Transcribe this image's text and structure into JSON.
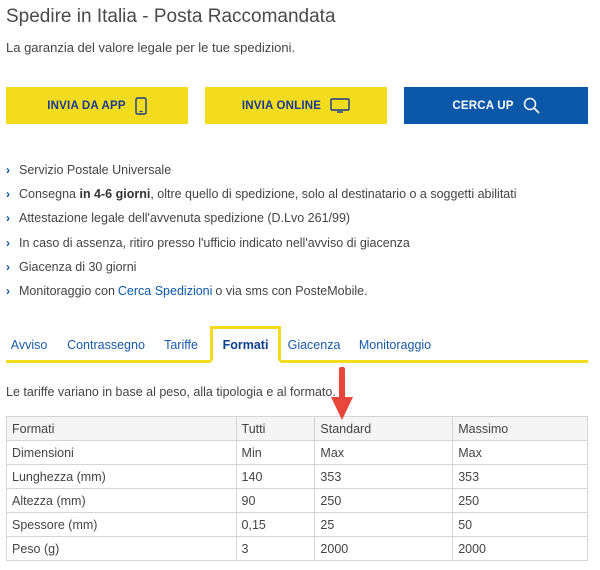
{
  "page": {
    "title": "Spedire in Italia - Posta Raccomandata",
    "subtitle": "La garanzia del valore legale per le tue spedizioni."
  },
  "buttons": {
    "app": "INVIA DA APP",
    "online": "INVIA ONLINE",
    "cerca": "CERCA UP"
  },
  "features": [
    {
      "text": "Servizio Postale Universale"
    },
    {
      "pre": "Consegna ",
      "bold": "in 4-6 giorni",
      "post": ", oltre quello di spedizione, solo al destinatario o a soggetti abilitati"
    },
    {
      "text": "Attestazione legale dell'avvenuta spedizione (D.Lvo 261/99)"
    },
    {
      "text": "In caso di assenza, ritiro presso l'ufficio indicato nell'avviso di giacenza"
    },
    {
      "text": "Giacenza di 30 giorni"
    },
    {
      "pre": "Monitoraggio con",
      "link": "Cerca Spedizioni",
      "post": "o via sms con PosteMobile."
    }
  ],
  "tabs": [
    "Avviso",
    "Contrassegno",
    "Tariffe",
    "Formati",
    "Giacenza",
    "Monitoraggio"
  ],
  "active_tab": "Formati",
  "note": "Le tariffe variano in base al peso, alla tipologia e al formato.",
  "table": {
    "headers": [
      "Formati",
      "Tutti",
      "Standard",
      "Massimo"
    ],
    "rows": [
      [
        "Dimensioni",
        "Min",
        "Max",
        "Max"
      ],
      [
        "Lunghezza (mm)",
        "140",
        "353",
        "353"
      ],
      [
        "Altezza (mm)",
        "90",
        "250",
        "250"
      ],
      [
        "Spessore (mm)",
        "0,15",
        "25",
        "50"
      ],
      [
        "Peso (g)",
        "3",
        "2000",
        "2000"
      ]
    ]
  },
  "colors": {
    "yellow": "#f2dc1c",
    "blue": "#0b57a8",
    "arrow": "#e8463a"
  }
}
